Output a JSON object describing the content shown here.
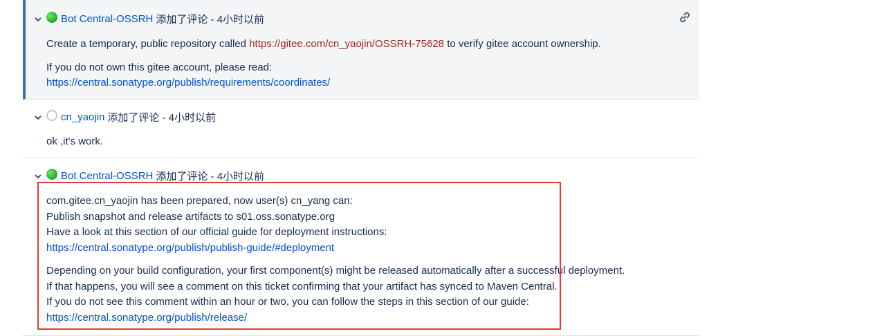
{
  "comments": [
    {
      "user": "Bot Central-OSSRH",
      "action": "添加了评论 - 4小时以前",
      "avatar_color": "#2eb82e",
      "line1_prefix": "Create a temporary, public repository called ",
      "line1_url": "https://gitee.com/cn_yaojin/OSSRH-75628",
      "line1_suffix": " to verify gitee account ownership.",
      "line2": "If you do not own this gitee account, please read:",
      "line3_url": "https://central.sonatype.org/publish/requirements/coordinates/"
    },
    {
      "user": "cn_yaojin",
      "action": "添加了评论 - 4小时以前",
      "text": "ok ,it's work."
    },
    {
      "user": "Bot Central-OSSRH",
      "action": "添加了评论 - 4小时以前",
      "avatar_color": "#2eb82e",
      "lines_a": [
        "com.gitee.cn_yaojin has been prepared, now user(s) cn_yang can:",
        "Publish snapshot and release artifacts to s01.oss.sonatype.org",
        "Have a look at this section of our official guide for deployment instructions:"
      ],
      "url_a": "https://central.sonatype.org/publish/publish-guide/#deployment",
      "lines_b": [
        "Depending on your build configuration, your first component(s) might be released automatically after a successful deployment.",
        "If that happens, you will see a comment on this ticket confirming that your artifact has synced to Maven Central.",
        "If you do not see this comment within an hour or two, you can follow the steps in this section of our guide:"
      ],
      "url_b": "https://central.sonatype.org/publish/release/"
    }
  ],
  "colors": {
    "link": "#0052cc",
    "highlight": "#e53935",
    "accent_bar": "#3572b0"
  }
}
